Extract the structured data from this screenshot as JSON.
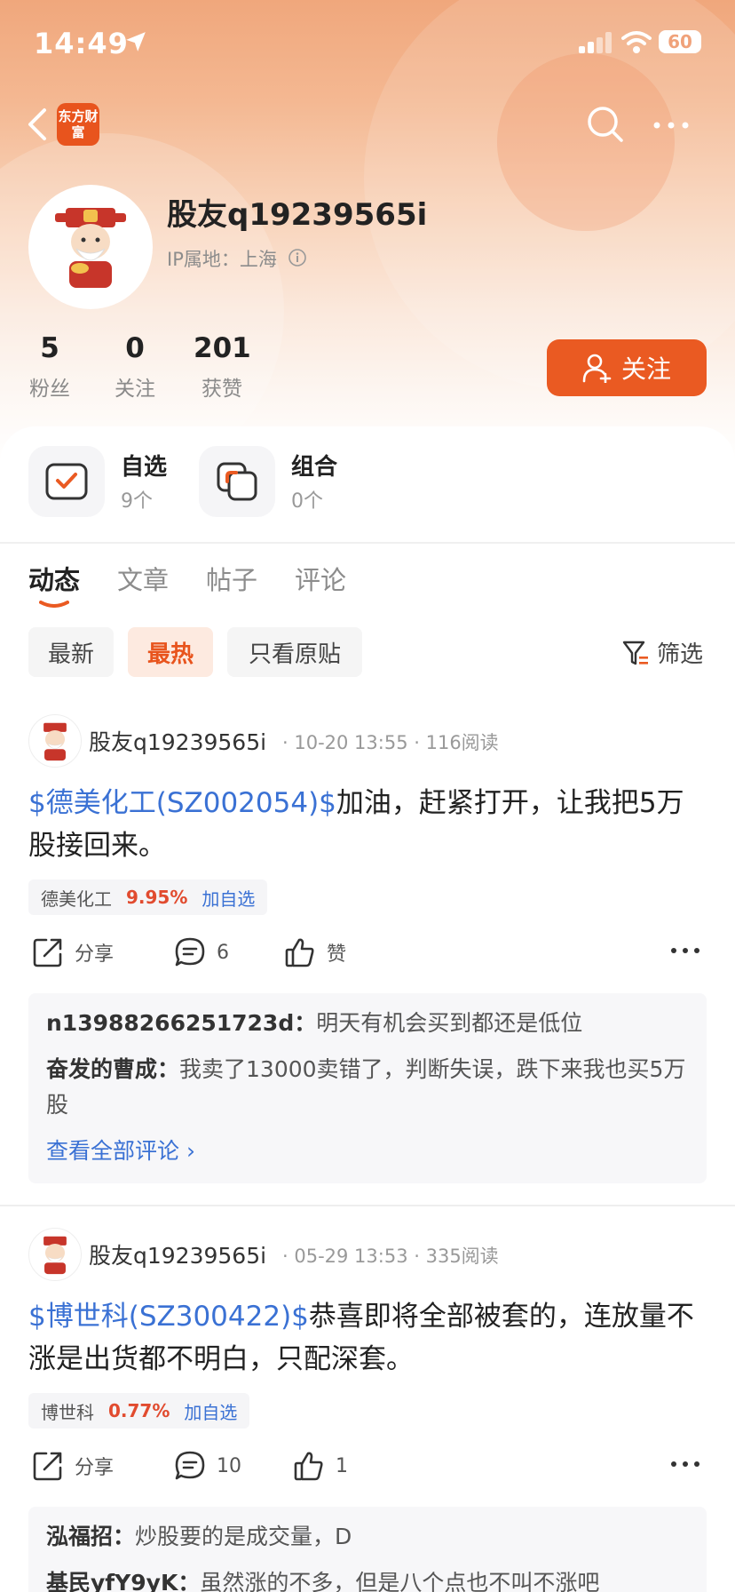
{
  "status": {
    "time": "14:49",
    "battery": "60"
  },
  "nav": {
    "logo_text": "东方财富"
  },
  "profile": {
    "name": "股友q19239565i",
    "ip": "IP属地：上海"
  },
  "stats": [
    {
      "value": "5",
      "label": "粉丝"
    },
    {
      "value": "0",
      "label": "关注"
    },
    {
      "value": "201",
      "label": "获赞"
    }
  ],
  "follow_label": "关注",
  "quick": [
    {
      "title": "自选",
      "sub": "9个"
    },
    {
      "title": "组合",
      "sub": "0个"
    }
  ],
  "tabs": [
    "动态",
    "文章",
    "帖子",
    "评论"
  ],
  "filters": [
    "最新",
    "最热",
    "只看原贴"
  ],
  "screen_label": "筛选",
  "posts": [
    {
      "author": "股友q19239565i",
      "meta": "· 10-20 13:55 · 116阅读",
      "stock": "$德美化工(SZ002054)$",
      "text": "加油，赶紧打开，让我把5万股接回来。",
      "chip_name": "德美化工",
      "chip_pct": "9.95%",
      "chip_add": "加自选",
      "share": "分享",
      "comments": "6",
      "likes": "赞",
      "replies": [
        {
          "user": "n13988266251723d：",
          "text": "明天有机会买到都还是低位"
        },
        {
          "user": "奋发的曹成：",
          "text": "我卖了13000卖错了，判断失误，跌下来我也买5万股"
        }
      ],
      "view_all": "查看全部评论 ›"
    },
    {
      "author": "股友q19239565i",
      "meta": "· 05-29 13:53 · 335阅读",
      "stock": "$博世科(SZ300422)$",
      "text": "恭喜即将全部被套的，连放量不涨是出货都不明白，只配深套。",
      "chip_name": "博世科",
      "chip_pct": "0.77%",
      "chip_add": "加自选",
      "share": "分享",
      "comments": "10",
      "likes": "1",
      "replies": [
        {
          "user": "泓福招：",
          "text": "炒股要的是成交量，D"
        },
        {
          "user": "基民yfY9yK：",
          "text": "虽然涨的不多，但是八个点也不叫不涨吧"
        }
      ]
    }
  ],
  "colors": {
    "accent": "#ea5a22",
    "link": "#3a71d4",
    "up": "#e14b2f"
  }
}
